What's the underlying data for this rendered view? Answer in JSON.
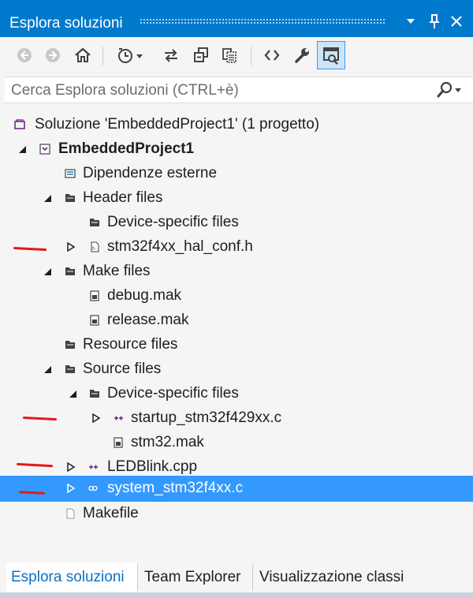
{
  "window": {
    "title": "Esplora soluzioni",
    "buttons": [
      {
        "name": "dropdown-button",
        "icon": "chevron-down-icon",
        "glyph": "▾"
      },
      {
        "name": "pin-button",
        "icon": "pin-icon",
        "glyph": "📌"
      },
      {
        "name": "close-button",
        "icon": "close-icon",
        "glyph": "✕"
      }
    ]
  },
  "toolbar": {
    "tools": [
      "back-icon",
      "forward-icon",
      "home-icon",
      "pending-changes-icon",
      "sync-icon",
      "collapse-all-icon",
      "show-all-files-icon",
      "view-code-icon",
      "properties-icon",
      "preview-selected-icon"
    ]
  },
  "search": {
    "placeholder": "Cerca Esplora soluzioni (CTRL+è)",
    "icon": "search-icon"
  },
  "tree": {
    "solution": {
      "label": "Soluzione 'EmbeddedProject1'  (1 progetto)"
    },
    "project": {
      "label": "EmbeddedProject1"
    },
    "items": {
      "external_deps": "Dipendenze esterne",
      "header_files": "Header files",
      "header_device_specific": "Device-specific files",
      "hal_conf": "stm32f4xx_hal_conf.h",
      "make_files": "Make files",
      "debug_mak": "debug.mak",
      "release_mak": "release.mak",
      "resource_files": "Resource files",
      "source_files": "Source files",
      "source_device_specific": "Device-specific files",
      "startup": "startup_stm32f429xx.c",
      "stm32_mak": "stm32.mak",
      "ledblink": "LEDBlink.cpp",
      "system": "system_stm32f4xx.c",
      "makefile": "Makefile"
    },
    "selected": "system_stm32f4xx.c"
  },
  "tabs": [
    {
      "label": "Esplora soluzioni",
      "active": true
    },
    {
      "label": "Team Explorer",
      "active": false
    },
    {
      "label": "Visualizzazione classi",
      "active": false
    }
  ],
  "colors": {
    "accent": "#007acc",
    "selection": "#3399ff",
    "annotation": "#e31919"
  }
}
